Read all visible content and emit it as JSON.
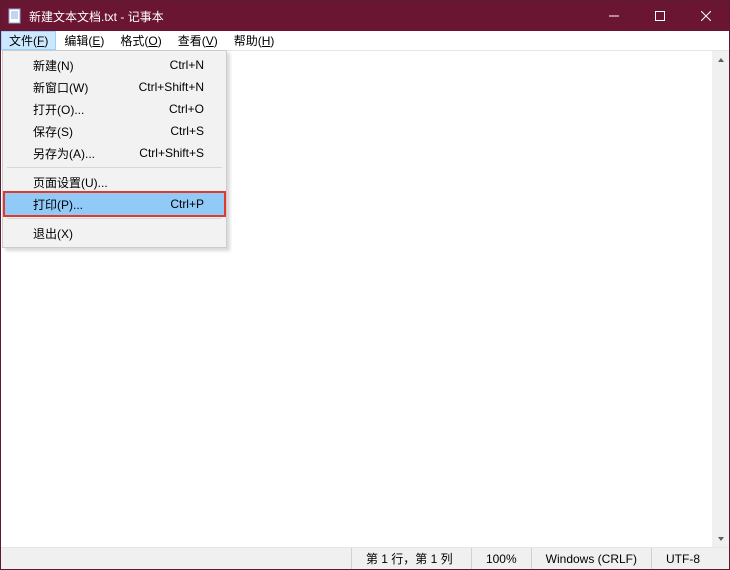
{
  "titlebar": {
    "filename": "新建文本文档.txt",
    "separator": " - ",
    "appname": "记事本"
  },
  "menubar": {
    "file": {
      "label_pre": "文件(",
      "ul": "F",
      "label_post": ")"
    },
    "edit": {
      "label_pre": "编辑(",
      "ul": "E",
      "label_post": ")"
    },
    "format": {
      "label_pre": "格式(",
      "ul": "O",
      "label_post": ")"
    },
    "view": {
      "label_pre": "查看(",
      "ul": "V",
      "label_post": ")"
    },
    "help": {
      "label_pre": "帮助(",
      "ul": "H",
      "label_post": ")"
    }
  },
  "file_menu": {
    "new": {
      "label": "新建(N)",
      "shortcut": "Ctrl+N"
    },
    "new_window": {
      "label": "新窗口(W)",
      "shortcut": "Ctrl+Shift+N"
    },
    "open": {
      "label": "打开(O)...",
      "shortcut": "Ctrl+O"
    },
    "save": {
      "label": "保存(S)",
      "shortcut": "Ctrl+S"
    },
    "save_as": {
      "label": "另存为(A)...",
      "shortcut": "Ctrl+Shift+S"
    },
    "page_setup": {
      "label": "页面设置(U)...",
      "shortcut": ""
    },
    "print": {
      "label": "打印(P)...",
      "shortcut": "Ctrl+P"
    },
    "exit": {
      "label": "退出(X)",
      "shortcut": ""
    }
  },
  "statusbar": {
    "position": "第 1 行，第 1 列",
    "zoom": "100%",
    "line_ending": "Windows (CRLF)",
    "encoding": "UTF-8"
  },
  "colors": {
    "titlebar_bg": "#6a1532",
    "highlight_bg": "#91c9f7",
    "redbox": "#e03a2f"
  }
}
